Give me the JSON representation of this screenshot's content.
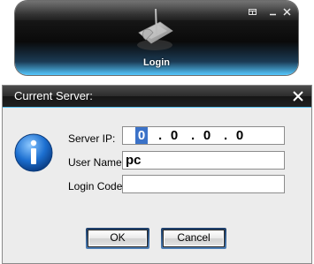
{
  "widget": {
    "label": "Login",
    "controls": [
      "restore-icon",
      "minimize-icon",
      "close-icon"
    ]
  },
  "dialog": {
    "title": "Current Server:",
    "fields": {
      "server_ip_label": "Server IP:",
      "server_ip_octets": [
        "0",
        "0",
        "0",
        "0"
      ],
      "user_name_label": "User Name:",
      "user_name_value": "pc",
      "login_code_label": "Login Code:",
      "login_code_value": ""
    },
    "buttons": {
      "ok": "OK",
      "cancel": "Cancel"
    },
    "colors": {
      "accent": "#55c0ef",
      "info_icon": "#1c6fd0",
      "selection": "#3b72c8"
    }
  }
}
